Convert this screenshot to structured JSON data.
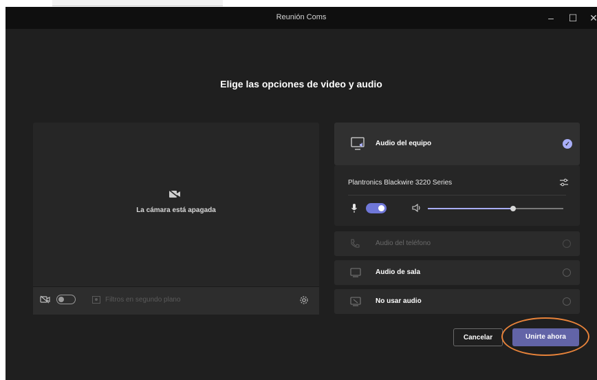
{
  "window": {
    "title": "Reunión Coms",
    "minimize_glyph": "–",
    "maximize_glyph": "☐",
    "close_glyph": "✕"
  },
  "heading": "Elige las opciones de video y audio",
  "preview": {
    "camera_off_text": "La cámara está apagada",
    "camera_toggle_on": false,
    "filters_label": "Filtros en segundo plano",
    "icons": [
      "camera-off-icon",
      "camera-toggle",
      "background-filters-icon",
      "gear-icon"
    ]
  },
  "audio_options": {
    "computer": {
      "label": "Audio del equipo",
      "selected": true,
      "check_glyph": "✓",
      "device_name": "Plantronics Blackwire 3220 Series",
      "mic_on": true,
      "volume_fraction": 0.63
    },
    "phone": {
      "label": "Audio del teléfono",
      "disabled": true
    },
    "room": {
      "label": "Audio de sala"
    },
    "none": {
      "label": "No usar audio"
    }
  },
  "buttons": {
    "cancel": "Cancelar",
    "join": "Unirte ahora"
  },
  "colors": {
    "accent": "#6264a7",
    "highlight_ring": "#e8833a",
    "background": "#1f1f1f"
  }
}
